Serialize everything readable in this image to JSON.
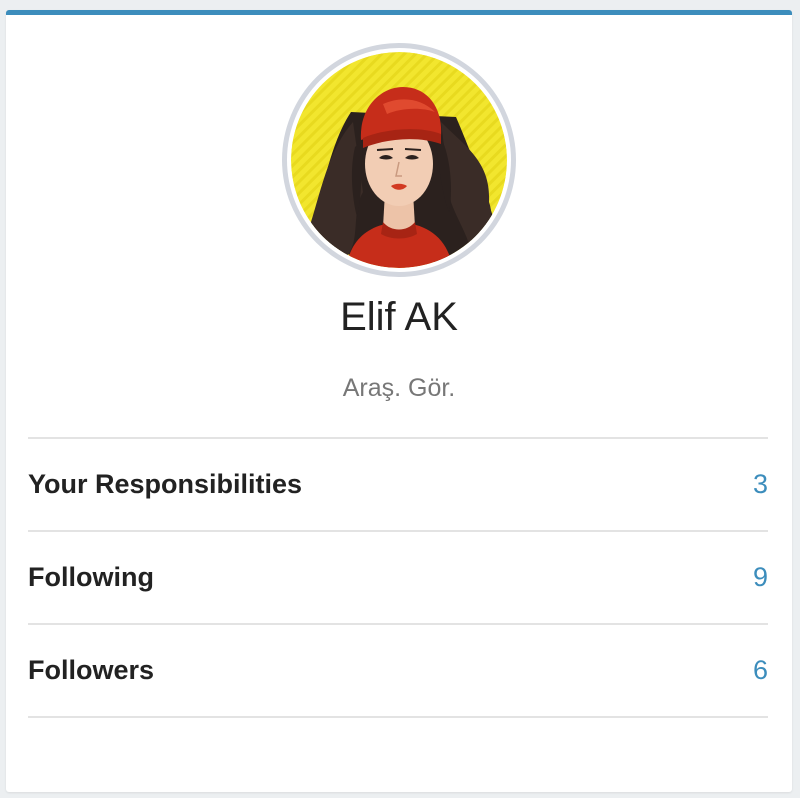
{
  "profile": {
    "name": "Elif AK",
    "role": "Araş. Gör."
  },
  "stats": [
    {
      "label": "Your Responsibilities",
      "value": "3"
    },
    {
      "label": "Following",
      "value": "9"
    },
    {
      "label": "Followers",
      "value": "6"
    }
  ],
  "colors": {
    "accent": "#3c8dbc",
    "avatar_background": "#f5e52a"
  }
}
